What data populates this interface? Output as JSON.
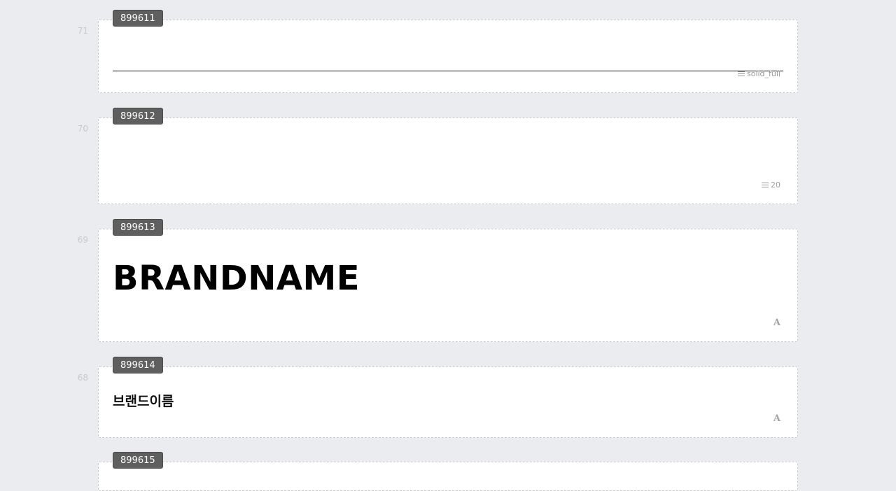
{
  "blocks": [
    {
      "row_number": "71",
      "id": "899611",
      "meta_label": "solid_full",
      "meta_icon": "lines-icon"
    },
    {
      "row_number": "70",
      "id": "899612",
      "meta_label": "20",
      "meta_icon": "lines-icon"
    },
    {
      "row_number": "69",
      "id": "899613",
      "text": "BRANDNAME",
      "meta_icon": "font-icon",
      "meta_glyph": "A"
    },
    {
      "row_number": "68",
      "id": "899614",
      "text": "브랜드이름",
      "meta_icon": "font-icon",
      "meta_glyph": "A"
    },
    {
      "id": "899615"
    }
  ]
}
